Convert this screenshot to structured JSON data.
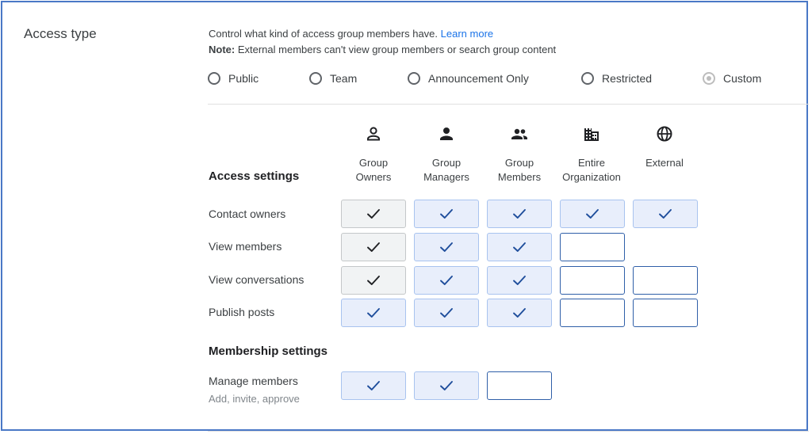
{
  "section_title": "Access type",
  "description": {
    "line1": "Control what kind of access group members have.",
    "learn_more": "Learn more",
    "note_label": "Note:",
    "note_text": " External members can't view group members or search group content"
  },
  "access_types": [
    {
      "label": "Public",
      "selected": false,
      "disabled": false
    },
    {
      "label": "Team",
      "selected": false,
      "disabled": false
    },
    {
      "label": "Announcement Only",
      "selected": false,
      "disabled": false
    },
    {
      "label": "Restricted",
      "selected": false,
      "disabled": false
    },
    {
      "label": "Custom",
      "selected": true,
      "disabled": true
    }
  ],
  "columns": [
    {
      "icon": "person-outline-icon",
      "line1": "Group",
      "line2": "Owners"
    },
    {
      "icon": "person-icon",
      "line1": "Group",
      "line2": "Managers"
    },
    {
      "icon": "people-icon",
      "line1": "Group",
      "line2": "Members"
    },
    {
      "icon": "building-icon",
      "line1": "Entire",
      "line2": "Organization"
    },
    {
      "icon": "globe-icon",
      "line1": "External",
      "line2": ""
    }
  ],
  "access_settings": {
    "heading": "Access settings",
    "rows": [
      {
        "label": "Contact owners",
        "cells": [
          "check-locked",
          "check",
          "check",
          "check",
          "check"
        ]
      },
      {
        "label": "View members",
        "cells": [
          "check-locked",
          "check",
          "check",
          "empty",
          "none"
        ]
      },
      {
        "label": "View conversations",
        "cells": [
          "check-locked",
          "check",
          "check",
          "empty",
          "empty"
        ]
      },
      {
        "label": "Publish posts",
        "cells": [
          "check",
          "check",
          "check",
          "empty",
          "empty"
        ]
      }
    ]
  },
  "membership_settings": {
    "heading": "Membership settings",
    "rows": [
      {
        "label": "Manage members",
        "sublabel": "Add, invite, approve",
        "cells": [
          "check",
          "check",
          "empty",
          "none",
          "none"
        ]
      }
    ]
  },
  "colors": {
    "link": "#1a73e8",
    "check_dark": "#202124",
    "check_blue": "#1f4e9c",
    "cell_blue_bg": "#e8eefb",
    "cell_grey_bg": "#f1f3f4",
    "frame_border": "#4a78c6"
  }
}
